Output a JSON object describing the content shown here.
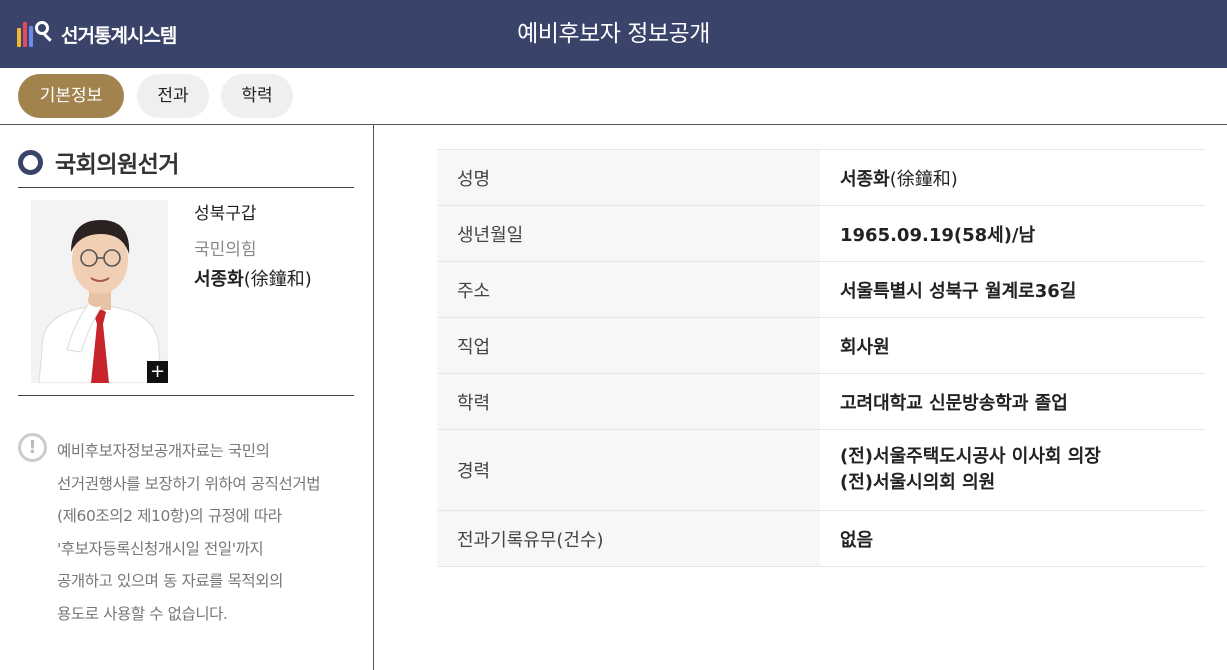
{
  "header": {
    "logo_text": "선거통계시스템",
    "title": "예비후보자 정보공개",
    "background": "#3a4369"
  },
  "tabs": [
    {
      "label": "기본정보",
      "active": true
    },
    {
      "label": "전과",
      "active": false
    },
    {
      "label": "학력",
      "active": false
    }
  ],
  "candidate": {
    "election": "국회의원선거",
    "district": "성북구갑",
    "party": "국민의힘",
    "name": "서종화",
    "hanja": "(徐鐘和)"
  },
  "notice": {
    "icon": "exclamation-icon",
    "lines": [
      "예비후보자정보공개자료는 국민의",
      "선거권행사를 보장하기 위하여 공직선거법",
      "(제60조의2 제10항)의 규정에 따라",
      "'후보자등록신청개시일 전일'까지",
      "공개하고 있으며 동 자료를 목적외의",
      "용도로 사용할 수 없습니다."
    ]
  },
  "info": {
    "rows": [
      {
        "label": "성명",
        "name": "서종화",
        "hanja": "(徐鐘和)"
      },
      {
        "label": "생년월일",
        "value": "1965.09.19(58세)/남"
      },
      {
        "label": "주소",
        "value": "서울특별시 성북구 월계로36길"
      },
      {
        "label": "직업",
        "value": "회사원"
      },
      {
        "label": "학력",
        "value": "고려대학교 신문방송학과 졸업"
      },
      {
        "label": "경력",
        "lines": [
          "(전)서울주택도시공사 이사회 의장",
          "(전)서울시의회 의원"
        ]
      },
      {
        "label": "전과기록유무(건수)",
        "value": "없음"
      }
    ]
  },
  "colors": {
    "accent_tab": "#a2834e",
    "header": "#3a4369"
  }
}
